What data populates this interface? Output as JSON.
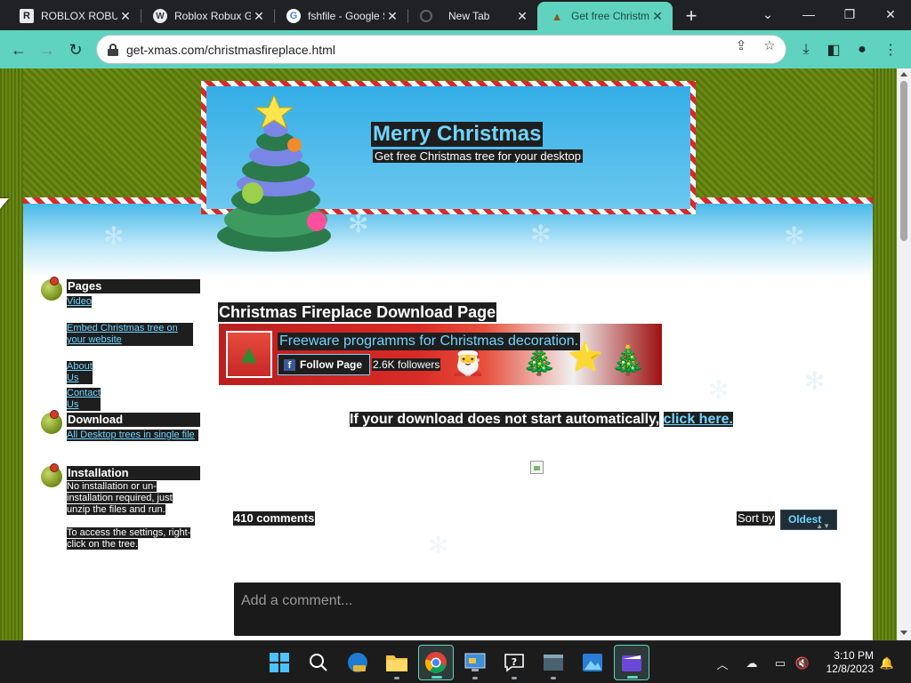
{
  "browser": {
    "tabs": [
      {
        "title": "ROBLOX ROBUX",
        "favicon": "R"
      },
      {
        "title": "Roblox Robux Generator",
        "favicon": "W"
      },
      {
        "title": "fshfile - Google Search",
        "favicon": "G"
      },
      {
        "title": "New Tab",
        "favicon": ""
      },
      {
        "title": "Get free Christmas",
        "favicon": ""
      }
    ],
    "url": "get-xmas.com/christmasfireplace.html",
    "accent_color": "#5fd3bf"
  },
  "site": {
    "title": "Merry Christmas",
    "subtitle": "Get free Christmas tree for your desktop"
  },
  "sidebar": {
    "pages_heading": "Pages",
    "pages_links": [
      "Video",
      "Embed Christmas tree on your website",
      "About Us",
      "Contact Us"
    ],
    "download_heading": "Download",
    "download_link": "All Desktop trees in single file",
    "installation_heading": "Installation",
    "installation_text1": "No installation or un-installation required, just unzip the files and run.",
    "installation_text2": "To access the settings, right-click on the tree."
  },
  "main": {
    "title": "Christmas Fireplace Download Page",
    "fb": {
      "name": "Freeware programms for Christmas decoration.",
      "follow_label": "Follow Page",
      "followers": "2.6K followers"
    },
    "download_text": "If your download does not start automatically,",
    "download_link": "click here.",
    "comments_count": "410 comments",
    "sort_label": "Sort by",
    "sort_value": "Oldest",
    "comment_placeholder": "Add a comment..."
  },
  "taskbar": {
    "time": "3:10 PM",
    "date": "12/8/2023"
  }
}
